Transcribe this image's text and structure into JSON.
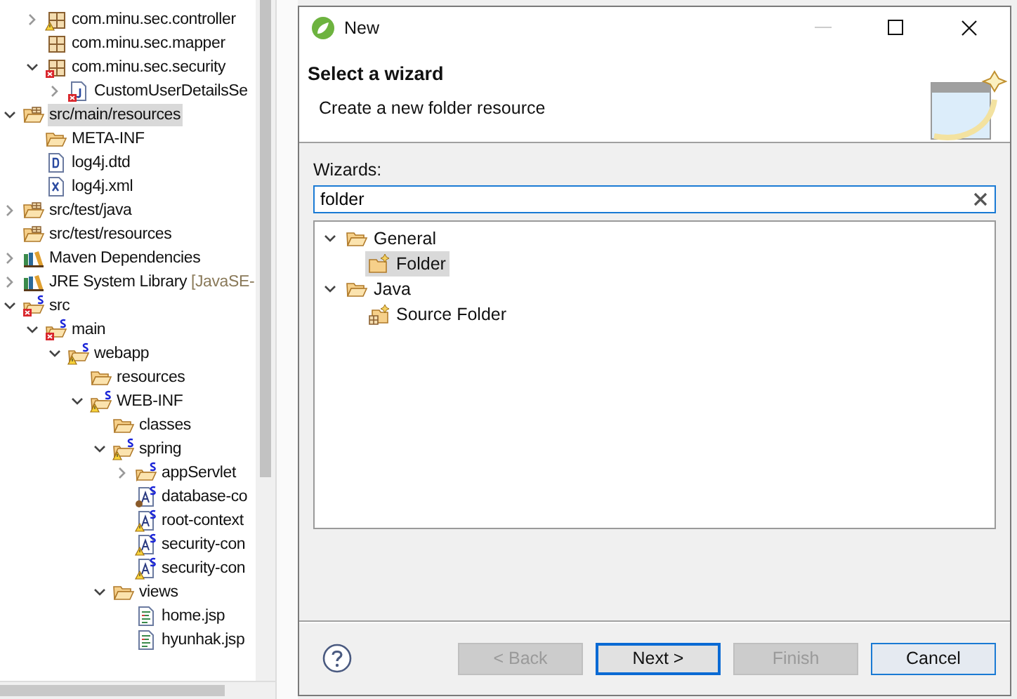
{
  "explorer": {
    "tree": [
      {
        "children": [
          {
            "label": "com.minu.sec.controller",
            "kind": "package",
            "warning": true,
            "expanded": false,
            "selected": false
          },
          {
            "label": "com.minu.sec.mapper",
            "kind": "package",
            "selected": false
          },
          {
            "label": "com.minu.sec.security",
            "kind": "package",
            "error": true,
            "expanded": true,
            "selected": false,
            "children": [
              {
                "label": "CustomUserDetailsSe",
                "kind": "java-file",
                "error": true,
                "expanded": false,
                "selected": false
              }
            ]
          }
        ]
      },
      {
        "label": "src/main/resources",
        "kind": "source-folder",
        "expanded": true,
        "selected": true,
        "children": [
          {
            "label": "META-INF",
            "kind": "folder",
            "selected": false
          },
          {
            "label": "log4j.dtd",
            "kind": "dtd-file",
            "selected": false
          },
          {
            "label": "log4j.xml",
            "kind": "xml-file",
            "selected": false
          }
        ]
      },
      {
        "label": "src/test/java",
        "kind": "source-folder",
        "expanded": false,
        "selected": false
      },
      {
        "label": "src/test/resources",
        "kind": "source-folder",
        "selected": false
      },
      {
        "label": "Maven Dependencies",
        "kind": "library",
        "expanded": false,
        "selected": false
      },
      {
        "label": "JRE System Library",
        "decoration": "[JavaSE-",
        "kind": "library",
        "expanded": false,
        "selected": false
      },
      {
        "label": "src",
        "kind": "folder",
        "spring": true,
        "error": true,
        "expanded": true,
        "selected": false,
        "children": [
          {
            "label": "main",
            "kind": "folder",
            "spring": true,
            "error": true,
            "expanded": true,
            "selected": false,
            "children": [
              {
                "label": "webapp",
                "kind": "folder",
                "spring": true,
                "warning": true,
                "expanded": true,
                "selected": false,
                "children": [
                  {
                    "label": "resources",
                    "kind": "folder",
                    "selected": false
                  },
                  {
                    "label": "WEB-INF",
                    "kind": "folder",
                    "spring": true,
                    "warning": true,
                    "expanded": true,
                    "selected": false,
                    "children": [
                      {
                        "label": "classes",
                        "kind": "folder",
                        "selected": false
                      },
                      {
                        "label": "spring",
                        "kind": "folder",
                        "spring": true,
                        "warning": true,
                        "expanded": true,
                        "selected": false,
                        "children": [
                          {
                            "label": "appServlet",
                            "kind": "folder",
                            "spring": true,
                            "expanded": false,
                            "selected": false
                          },
                          {
                            "label": "database-co",
                            "kind": "bean-file",
                            "spring": true,
                            "running": true,
                            "selected": false
                          },
                          {
                            "label": "root-context",
                            "kind": "bean-file",
                            "spring": true,
                            "warning": true,
                            "selected": false
                          },
                          {
                            "label": "security-con",
                            "kind": "bean-file",
                            "spring": true,
                            "warning": true,
                            "selected": false
                          },
                          {
                            "label": "security-con",
                            "kind": "bean-file",
                            "spring": true,
                            "warning": true,
                            "selected": false
                          }
                        ]
                      },
                      {
                        "label": "views",
                        "kind": "folder",
                        "expanded": true,
                        "selected": false,
                        "children": [
                          {
                            "label": "home.jsp",
                            "kind": "jsp-file",
                            "selected": false
                          },
                          {
                            "label": "hyunhak.jsp",
                            "kind": "jsp-file",
                            "selected": false
                          }
                        ]
                      }
                    ]
                  }
                ]
              }
            ]
          }
        ]
      }
    ]
  },
  "dialog": {
    "title": "New",
    "header": {
      "title": "Select a wizard",
      "description": "Create a new folder resource"
    },
    "wizards_label": "Wizards:",
    "filter": {
      "value": "folder"
    },
    "wizard_tree": [
      {
        "label": "General",
        "kind": "folder",
        "expanded": true,
        "selected": false,
        "children": [
          {
            "label": "Folder",
            "kind": "new-folder",
            "selected": true
          }
        ]
      },
      {
        "label": "Java",
        "kind": "folder",
        "expanded": true,
        "selected": false,
        "children": [
          {
            "label": "Source Folder",
            "kind": "new-source-folder",
            "selected": false
          }
        ]
      }
    ],
    "buttons": [
      {
        "label": "< Back",
        "disabled": true,
        "default": false
      },
      {
        "label": "Next >",
        "disabled": false,
        "default": true
      },
      {
        "label": "Finish",
        "disabled": true,
        "default": false
      },
      {
        "label": "Cancel",
        "disabled": false,
        "default": false
      }
    ]
  }
}
